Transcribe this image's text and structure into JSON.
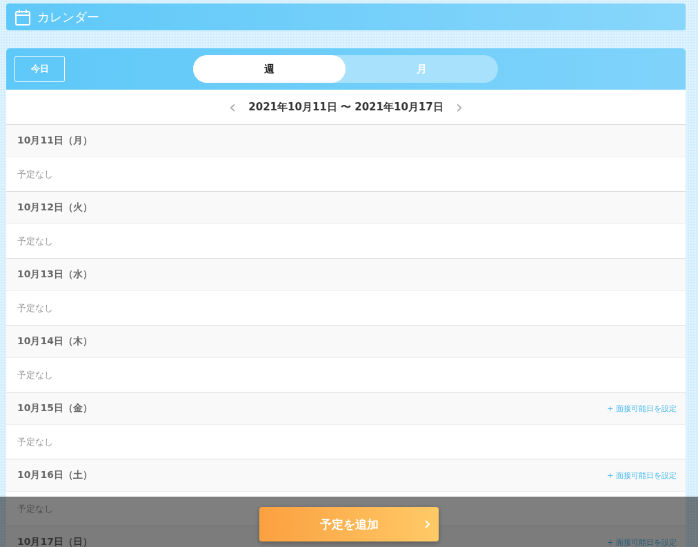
{
  "header": {
    "title": "カレンダー"
  },
  "toolbar": {
    "today_button": "今日",
    "view_tabs": [
      {
        "label": "週",
        "selected": true
      },
      {
        "label": "月",
        "selected": false
      }
    ]
  },
  "range": {
    "prev": "‹",
    "label": "2021年10月11日 〜 2021年10月17日",
    "next": "›"
  },
  "days": [
    {
      "date": "10月11日（月）",
      "schedule": "予定なし"
    },
    {
      "date": "10月12日（火）",
      "schedule": "予定なし"
    },
    {
      "date": "10月13日（水）",
      "schedule": "予定なし"
    },
    {
      "date": "10月14日（木）",
      "schedule": "予定なし"
    },
    {
      "date": "10月15日（金）",
      "action": "+ 面接可能日を設定",
      "schedule": "予定なし"
    },
    {
      "date": "10月16日（土）",
      "action": "+ 面接可能日を設定",
      "schedule": "予定なし"
    },
    {
      "date": "10月17日（日）",
      "action": "+ 面接可能日を設定"
    }
  ],
  "footer": {
    "add_button": "予定を追加"
  }
}
